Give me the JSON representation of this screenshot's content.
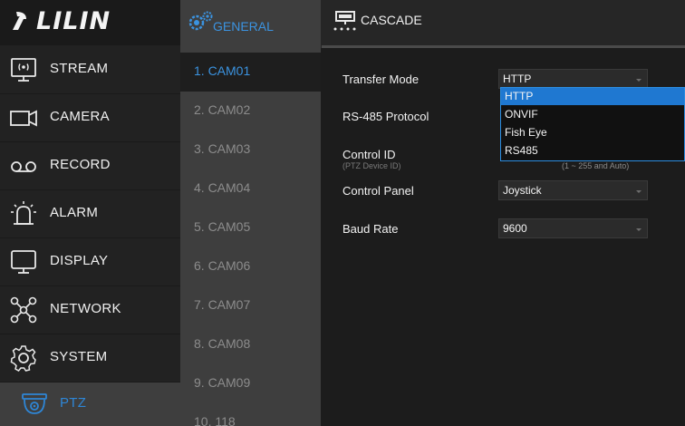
{
  "brand": {
    "logo_text": "LILIN"
  },
  "sidebar": {
    "items": [
      {
        "label": "STREAM",
        "icon": "stream-icon"
      },
      {
        "label": "CAMERA",
        "icon": "camera-icon"
      },
      {
        "label": "RECORD",
        "icon": "record-icon"
      },
      {
        "label": "ALARM",
        "icon": "alarm-icon"
      },
      {
        "label": "DISPLAY",
        "icon": "display-icon"
      },
      {
        "label": "NETWORK",
        "icon": "network-icon"
      },
      {
        "label": "SYSTEM",
        "icon": "gear-icon"
      },
      {
        "label": "PTZ",
        "icon": "ptz-dome-icon",
        "active": true
      }
    ]
  },
  "tabs": [
    {
      "label": "GENERAL",
      "icon": "gears-icon",
      "active": true
    },
    {
      "label": "CASCADE",
      "icon": "cascade-device-icon",
      "active": false
    }
  ],
  "cameras": [
    "1. CAM01",
    "2. CAM02",
    "3. CAM03",
    "4. CAM04",
    "5. CAM05",
    "6. CAM06",
    "7. CAM07",
    "8. CAM08",
    "9. CAM09",
    "10. 118"
  ],
  "selected_camera_index": 0,
  "form": {
    "transfer_mode": {
      "label": "Transfer Mode",
      "value": "HTTP"
    },
    "rs485_protocol": {
      "label": "RS-485 Protocol"
    },
    "control_id": {
      "label": "Control ID",
      "sublabel": "(PTZ Device ID)",
      "range_hint": "(1 ~ 255 and Auto)"
    },
    "control_panel": {
      "label": "Control Panel",
      "value": "Joystick"
    },
    "baud_rate": {
      "label": "Baud Rate",
      "value": "9600"
    }
  },
  "dropdown": {
    "options": [
      "HTTP",
      "ONVIF",
      "Fish Eye",
      "RS485"
    ],
    "selected": "HTTP"
  },
  "colors": {
    "accent": "#2e86d6",
    "selected_option": "#1f78d1"
  }
}
